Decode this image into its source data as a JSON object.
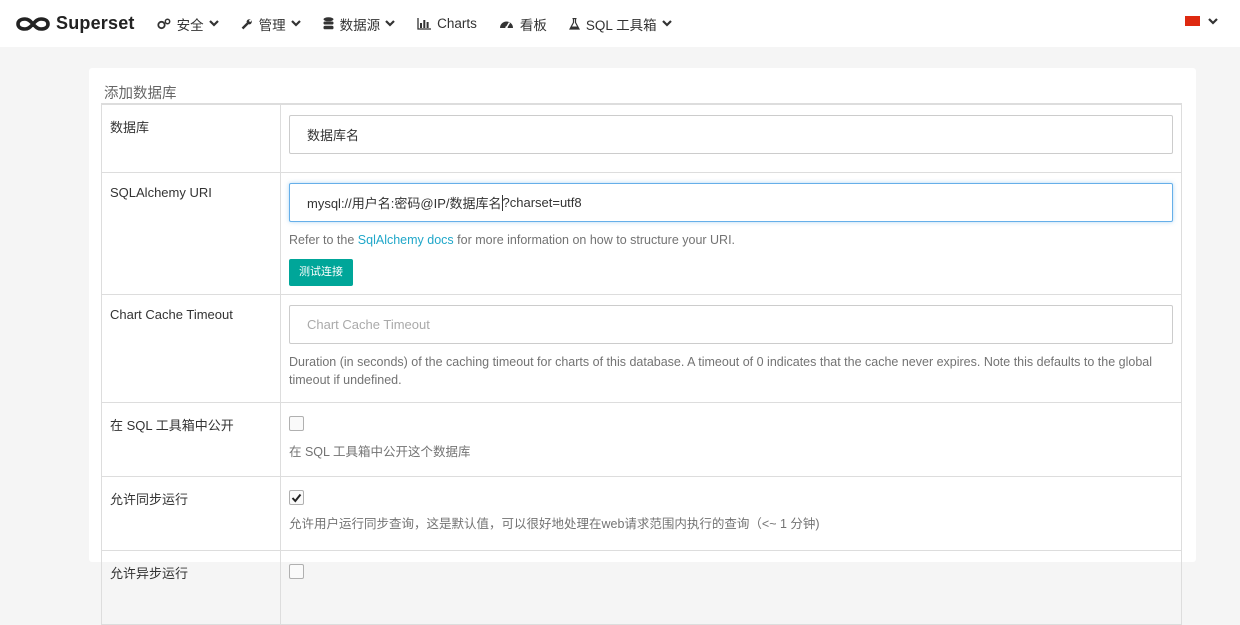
{
  "navbar": {
    "brand": "Superset",
    "items": [
      {
        "label": "安全",
        "icon": "cogs-icon",
        "caret": true
      },
      {
        "label": "管理",
        "icon": "wrench-icon",
        "caret": true
      },
      {
        "label": "数据源",
        "icon": "database-icon",
        "caret": true
      },
      {
        "label": "Charts",
        "icon": "bar-chart-icon",
        "caret": false
      },
      {
        "label": "看板",
        "icon": "dashboard-icon",
        "caret": false
      },
      {
        "label": "SQL 工具箱",
        "icon": "flask-icon",
        "caret": true
      }
    ],
    "language": {
      "icon": "china-flag-icon"
    }
  },
  "form": {
    "title": "添加数据库",
    "database": {
      "label": "数据库",
      "value": "数据库名"
    },
    "sqlalchemy": {
      "label": "SQLAlchemy URI",
      "value_before_cursor": "mysql://用户名:密码@IP/数据库名",
      "value_after_cursor": "?charset=utf8",
      "help_prefix": "Refer to the ",
      "help_link": "SqlAlchemy docs",
      "help_suffix": " for more information on how to structure your URI.",
      "test_button": "测试连接"
    },
    "cache_timeout": {
      "label": "Chart Cache Timeout",
      "placeholder": "Chart Cache Timeout",
      "help": "Duration (in seconds) of the caching timeout for charts of this database. A timeout of 0 indicates that the cache never expires. Note this defaults to the global timeout if undefined."
    },
    "expose_sql_lab": {
      "label": "在 SQL 工具箱中公开",
      "checked": false,
      "help": "在 SQL 工具箱中公开这个数据库"
    },
    "allow_run_sync": {
      "label": "允许同步运行",
      "checked": true,
      "help": "允许用户运行同步查询，这是默认值，可以很好地处理在web请求范围内执行的查询（<~ 1 分钟)"
    },
    "allow_run_async": {
      "label": "允许异步运行",
      "checked": false
    }
  }
}
